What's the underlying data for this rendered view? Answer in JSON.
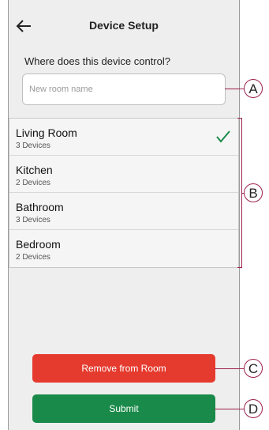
{
  "header": {
    "title": "Device Setup",
    "back_icon": "arrow-left-icon"
  },
  "form": {
    "question": "Where does this device control?",
    "input_value": "",
    "input_placeholder": "New room name"
  },
  "rooms": [
    {
      "name": "Living Room",
      "count": "3 Devices",
      "selected": true
    },
    {
      "name": "Kitchen",
      "count": "2 Devices",
      "selected": false
    },
    {
      "name": "Bathroom",
      "count": "3 Devices",
      "selected": false
    },
    {
      "name": "Bedroom",
      "count": "2 Devices",
      "selected": false
    }
  ],
  "buttons": {
    "remove_label": "Remove from Room",
    "submit_label": "Submit"
  },
  "callouts": [
    "A",
    "B",
    "C",
    "D"
  ],
  "colors": {
    "background": "#eeeeee",
    "remove_button": "#e53b2f",
    "submit_button": "#1a8a4a",
    "check": "#1a8a4a",
    "callout": "#9c1f4e"
  }
}
